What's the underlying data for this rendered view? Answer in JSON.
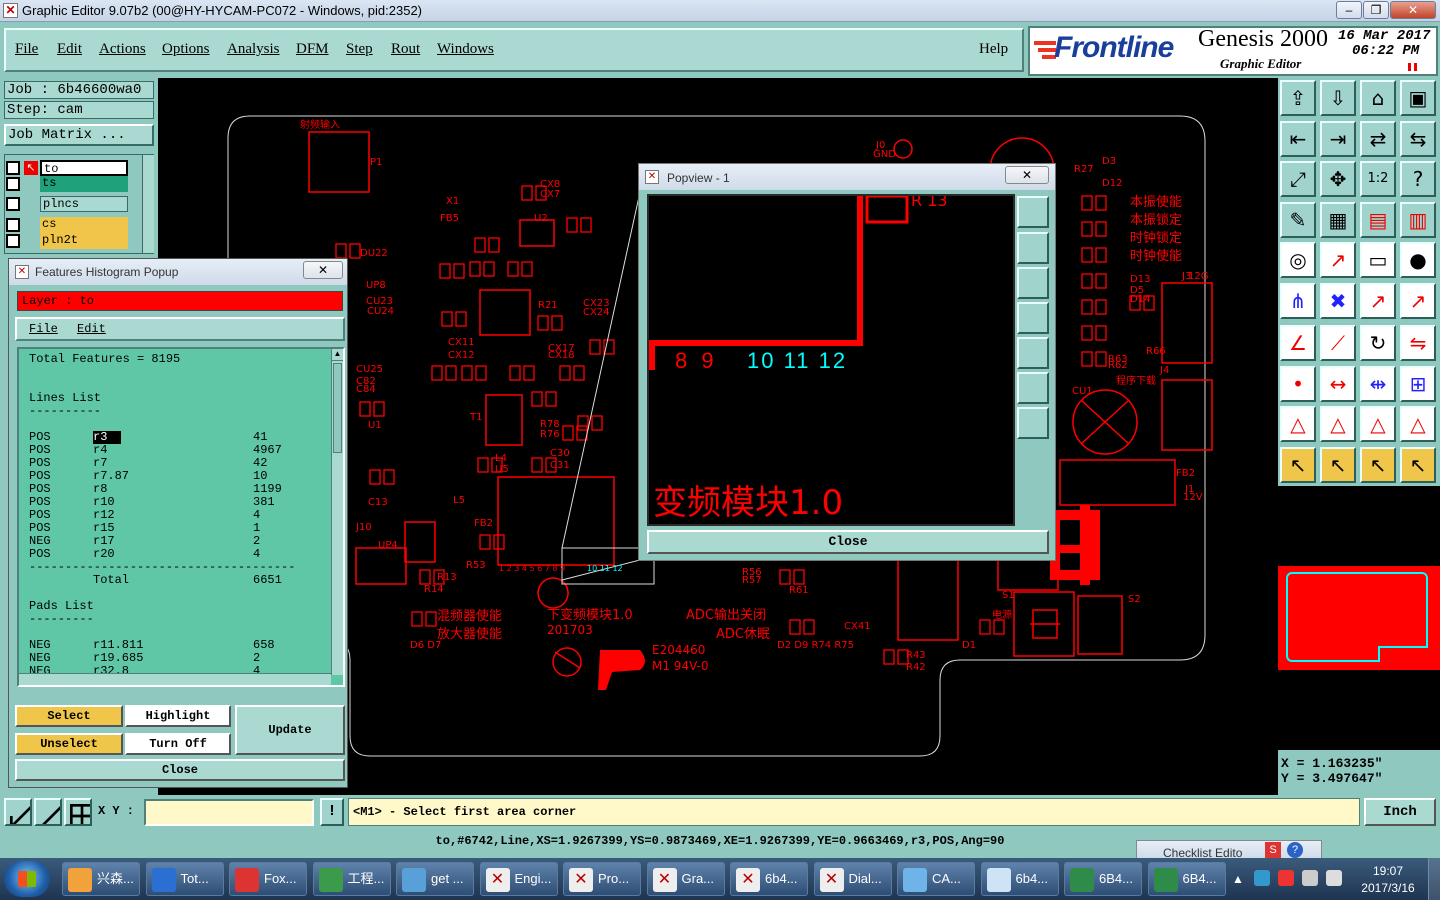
{
  "window": {
    "title": "Graphic Editor 9.07b2 (00@HY-HYCAM-PC072 - Windows, pid:2352)"
  },
  "menu": {
    "items": [
      "File",
      "Edit",
      "Actions",
      "Options",
      "Analysis",
      "DFM",
      "Step",
      "Rout",
      "Windows"
    ],
    "help": "Help"
  },
  "brand": {
    "logo": "Frontline",
    "product": "Genesis 2000",
    "subtitle": "Graphic Editor",
    "date": "16 Mar 2017",
    "time": "06:22 PM"
  },
  "job": {
    "job_label": "Job : 6b46600wa0",
    "step_label": "Step: cam",
    "matrix_button": "Job Matrix ..."
  },
  "layers": [
    {
      "name": "to",
      "color": "#ffffff"
    },
    {
      "name": "ts",
      "color": "#1fa27c"
    },
    {
      "name": "plncs",
      "color": "#a9d9d1"
    },
    {
      "name": "cs",
      "color": "#f0c64a"
    },
    {
      "name": "pln2t",
      "color": "#f0c64a"
    }
  ],
  "popview": {
    "title": "Popview - 1",
    "close": "Close",
    "numbers_red": [
      "8",
      "9"
    ],
    "numbers_cyan": [
      "10",
      "11",
      "12"
    ]
  },
  "histogram": {
    "title": "Features Histogram Popup",
    "layer_label": "Layer : to",
    "menu": [
      "File",
      "Edit"
    ],
    "total_features": "Total Features = 8195",
    "lines_title": "Lines List",
    "lines": [
      {
        "pol": "POS",
        "sym": "r3",
        "count": "41"
      },
      {
        "pol": "POS",
        "sym": "r4",
        "count": "4967"
      },
      {
        "pol": "POS",
        "sym": "r7",
        "count": "42"
      },
      {
        "pol": "POS",
        "sym": "r7.87",
        "count": "10"
      },
      {
        "pol": "POS",
        "sym": "r8",
        "count": "1199"
      },
      {
        "pol": "POS",
        "sym": "r10",
        "count": "381"
      },
      {
        "pol": "POS",
        "sym": "r12",
        "count": "4"
      },
      {
        "pol": "POS",
        "sym": "r15",
        "count": "1"
      },
      {
        "pol": "NEG",
        "sym": "r17",
        "count": "2"
      },
      {
        "pol": "POS",
        "sym": "r20",
        "count": "4"
      }
    ],
    "total_label": "Total",
    "total_value": "6651",
    "pads_title": "Pads List",
    "pads": [
      {
        "pol": "NEG",
        "sym": "r11.811",
        "count": "658"
      },
      {
        "pol": "NEG",
        "sym": "r19.685",
        "count": "2"
      },
      {
        "pol": "NEG",
        "sym": "r32.8",
        "count": "4"
      }
    ],
    "buttons": {
      "select": "Select",
      "highlight": "Highlight",
      "update": "Update",
      "unselect": "Unselect",
      "turn_off": "Turn Off",
      "close": "Close"
    }
  },
  "coords": {
    "x": "X = 1.163235\"",
    "y": "Y = 3.497647\""
  },
  "bottom": {
    "xy_label": "X Y :",
    "prompt": "<M1> - Select first area corner",
    "units": "Inch",
    "status": "to,#6742,Line,XS=1.9267399,YS=0.9873469,XE=1.9267399,YE=0.9663469,r3,POS,Ang=90",
    "checklist": "Checklist Edito"
  },
  "taskbar": {
    "items": [
      "兴森...",
      "Tot...",
      "Fox...",
      "工程...",
      "get ...",
      "Engi...",
      "Pro...",
      "Gra...",
      "6b4...",
      "Dial...",
      "CA...",
      "6b4...",
      "6B4...",
      "6B4..."
    ],
    "clock_time": "19:07",
    "clock_date": "2017/3/16"
  },
  "pcb_labels": {
    "l1": "射频输入",
    "l2": "本振使能",
    "l3": "本振锁定",
    "l4": "时钟锁定",
    "l5": "时钟使能",
    "l6": "混频器使能",
    "l7": "放大器使能",
    "l8": "下变频模块1.0",
    "l9": "201703",
    "l10": "ADC输出关闭",
    "l11": "ADC休眠",
    "l12": "E204460",
    "l13": "M1 94V-0",
    "l14": "程序下载"
  },
  "colors": {
    "bg": "#8ec8bf",
    "panel": "#a9d9d1",
    "red": "#ff0000",
    "cyan": "#00ffff"
  }
}
